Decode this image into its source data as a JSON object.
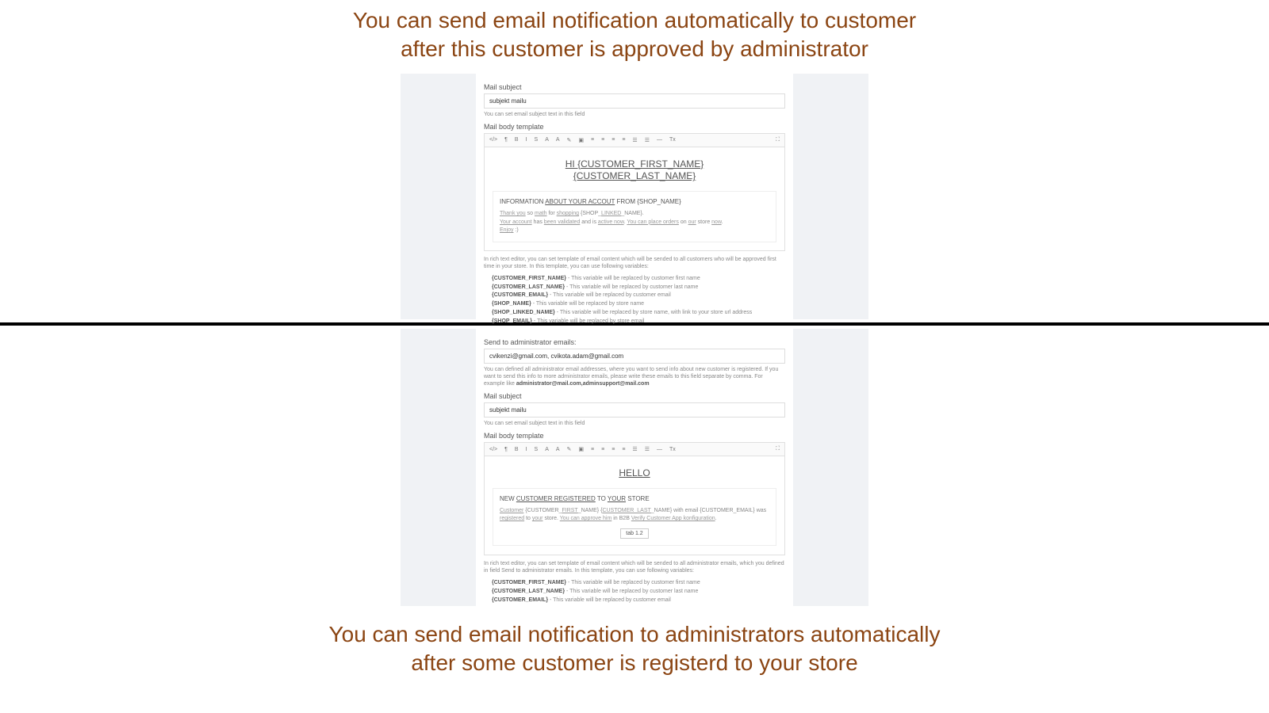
{
  "caption_top_line1": "You can send email notification automatically to customer",
  "caption_top_line2": "after this customer is approved by administrator",
  "caption_bottom_line1": "You can send email notification to administrators automatically",
  "caption_bottom_line2": "after some customer is registerd to your store",
  "panel1": {
    "subject_label": "Mail subject",
    "subject_value": "subjekt mailu",
    "subject_help": "You can set email subject text in this field",
    "body_label": "Mail body template",
    "editor_heading_l1": "HI {CUSTOMER_FIRST_NAME}",
    "editor_heading_l2": "{CUSTOMER_LAST_NAME}",
    "box_title_pre": "INFORMATION ",
    "box_title_u1": "ABOUT YOUR ACCOUT",
    "box_title_mid": " FROM {SHOP_NAME}",
    "box_body_html": "<span class='u'>Thank you</span> so <span class='u'>math</span> for <span class='u'>shopping</span> {SHOP_<span class='u'>LINKED</span>_NAME}.<br><span class='u'>Your account</span> has <span class='u'>been validated</span> and is <span class='u'>active now</span>. <span class='u'>You can place orders</span> on <span class='u'>our</span> store <span class='u'>now</span>.<br><span class='u'>Enjoy</span> :)",
    "rich_help": "In rich text editor, you can set template of email content which will be sended to all customers who will be approved first time in your store. In this template, you can use following variables:",
    "vars": [
      {
        "k": "{CUSTOMER_FIRST_NAME}",
        "v": " - This variable will be replaced by customer first name"
      },
      {
        "k": "{CUSTOMER_LAST_NAME}",
        "v": " - This variable will be replaced by customer last name"
      },
      {
        "k": "{CUSTOMER_EMAIL}",
        "v": " - This variable will be replaced by customer email"
      },
      {
        "k": "{SHOP_NAME}",
        "v": " - This variable will be replaced by store name"
      },
      {
        "k": "{SHOP_LINKED_NAME}",
        "v": " - This variable will be replaced by store name, with link to your store url address"
      },
      {
        "k": "{SHOP_EMAIL}",
        "v": " - This variable will be replaced by store email"
      }
    ]
  },
  "panel2": {
    "admin_label": "Send to administrator emails:",
    "admin_value": "cvikenzi@gmail.com, cvikota.adam@gmail.com",
    "admin_help_pre": "You can defined all administrator email addresses, where you want to send info about new customer is registered. If you want to send this info to more administrator emails, please write these emails to this field separate by comma. For example like ",
    "admin_help_bold": "administrator@mail.com,adminsupport@mail.com",
    "subject_label": "Mail subject",
    "subject_value": "subjekt mailu",
    "subject_help": "You can set email subject text in this field",
    "body_label": "Mail body template",
    "editor_heading": "HELLO",
    "box_title_pre": "NEW ",
    "box_title_u1": "CUSTOMER REGISTERED",
    "box_title_mid": " TO ",
    "box_title_u2": "YOUR",
    "box_title_post": " STORE",
    "box_body_html": "<span class='u'>Customer</span> {CUSTOMER_<span class='u'>FIRST</span>_NAME} {<span class='u'>CUSTOMER_LAST</span>_NAME} with email {CUSTOMER_EMAIL} was <span class='u'>registered</span> to <span class='u'>your</span> store. <span class='u'>You can approve him</span> in B2B <span class='u'>Verify Customer App konfiguration</span>.",
    "tab_label": "tab 1.2",
    "rich_help": "In rich text editor, you can set template of email content which will be sended to all administrator emails, which you defined in field Send to administrator emails. In this template, you can use following variables:",
    "vars": [
      {
        "k": "{CUSTOMER_FIRST_NAME}",
        "v": " - This variable will be replaced by customer first name"
      },
      {
        "k": "{CUSTOMER_LAST_NAME}",
        "v": " - This variable will be replaced by customer last name"
      },
      {
        "k": "{CUSTOMER_EMAIL}",
        "v": " - This variable will be replaced by customer email"
      }
    ]
  },
  "toolbar_icons": [
    "</>",
    "¶",
    "B",
    "I",
    "S",
    "A",
    "A",
    "✎",
    "▣",
    "≡",
    "≡",
    "≡",
    "≡",
    "☰",
    "☰",
    "—",
    "Tx",
    "",
    "⛶"
  ]
}
